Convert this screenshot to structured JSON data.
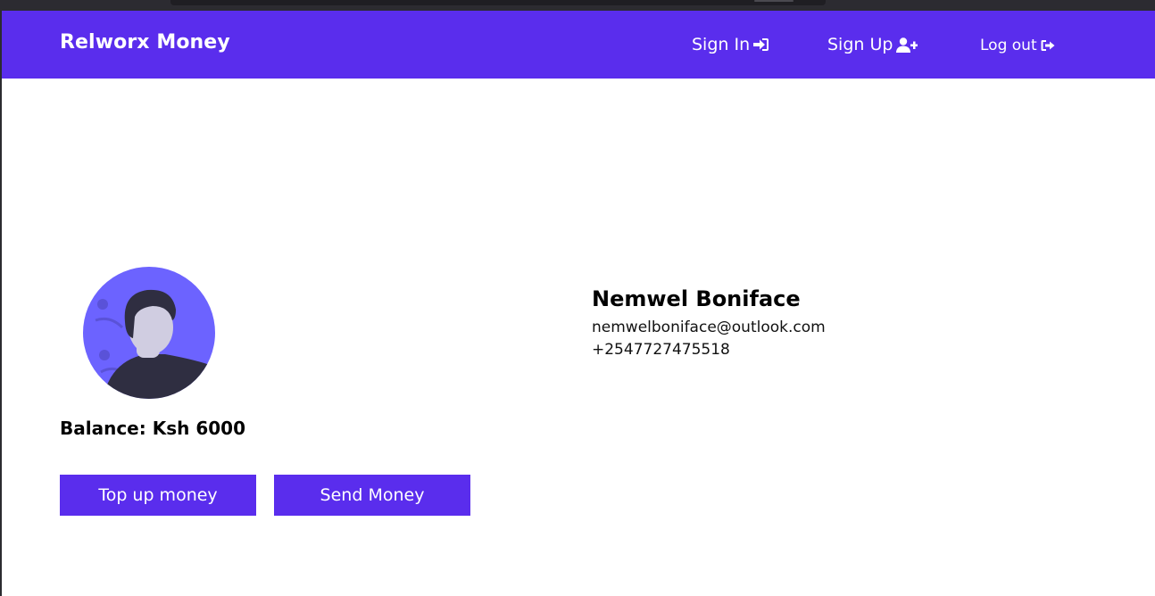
{
  "navbar": {
    "brand": "Relworx Money",
    "links": [
      {
        "label": "Sign In",
        "icon": "sign-in-icon"
      },
      {
        "label": "Sign Up",
        "icon": "user-plus-icon"
      },
      {
        "label": "Log out",
        "icon": "sign-out-icon"
      }
    ]
  },
  "account": {
    "balance_label": "Balance: Ksh 6000",
    "topup_label": "Top up money",
    "send_label": "Send Money"
  },
  "profile": {
    "name": "Nemwel Boniface",
    "email": "nemwelboniface@outlook.com",
    "phone": "+2547727475518"
  },
  "colors": {
    "primary": "#5a2ded",
    "avatar_bg": "#6c63ff",
    "avatar_shirt": "#2f2e41",
    "avatar_skin": "#d0cde1"
  }
}
